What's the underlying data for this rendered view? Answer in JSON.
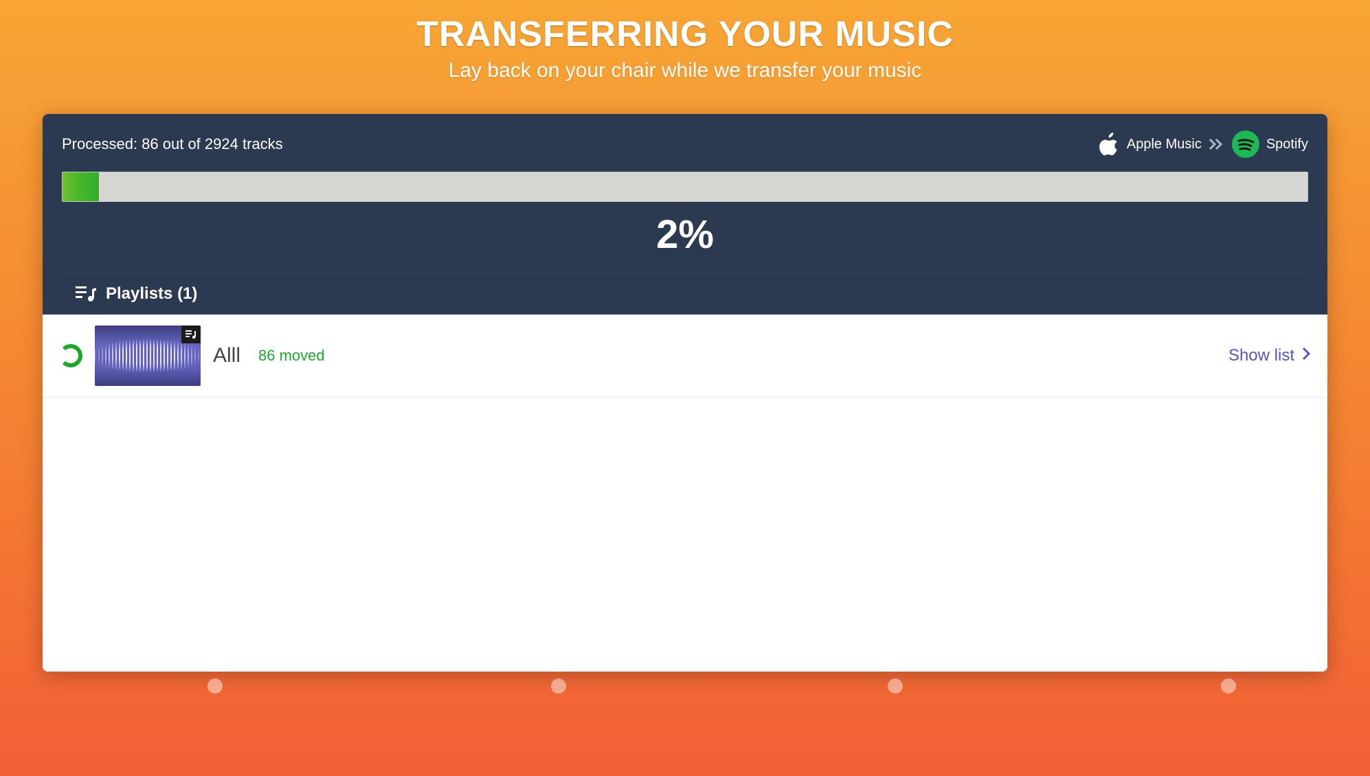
{
  "header": {
    "title": "TRANSFERRING YOUR MUSIC",
    "subtitle": "Lay back on your chair while we transfer your music"
  },
  "progress": {
    "processed_label": "Processed: 86 out of 2924 tracks",
    "percent_text": "2%",
    "percent_value": 2.94,
    "source_service": "Apple Music",
    "dest_service": "Spotify"
  },
  "sections": {
    "playlists_label": "Playlists (1)"
  },
  "playlists": [
    {
      "name": "Alll",
      "moved_label": "86 moved",
      "action_label": "Show list"
    }
  ],
  "colors": {
    "panel_bg": "#2b3a50",
    "accent_green": "#1aab2b",
    "link_purple": "#5552cc",
    "spotify_green": "#1db954"
  }
}
